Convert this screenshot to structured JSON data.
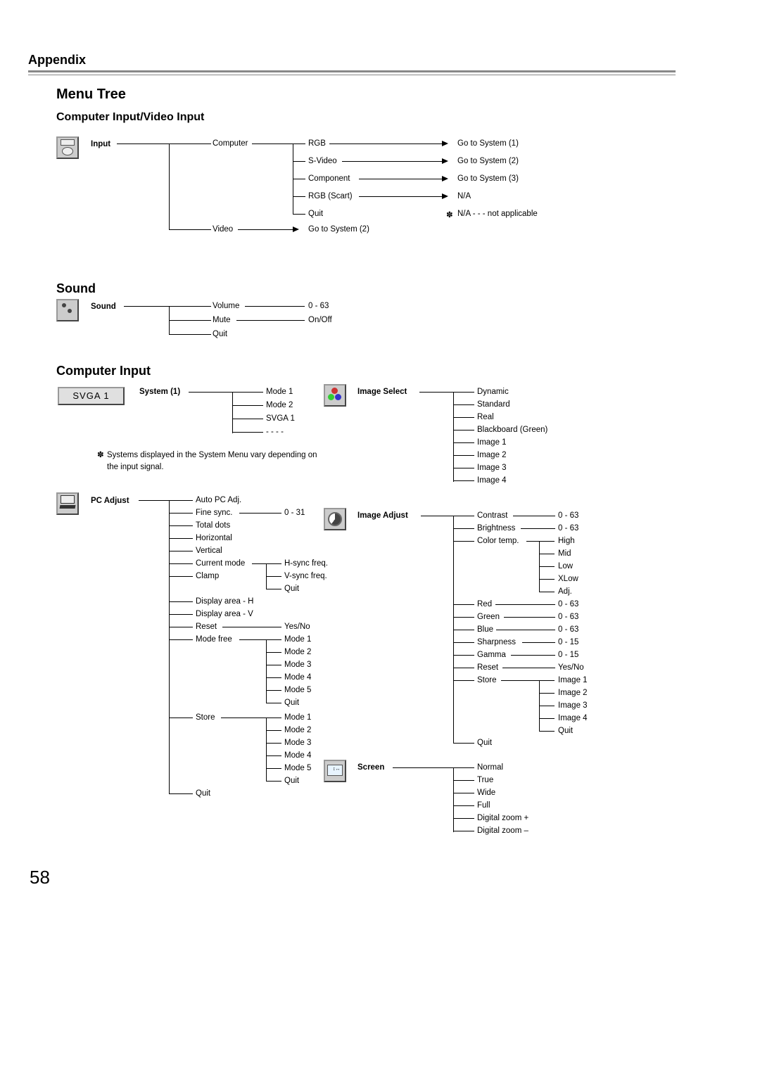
{
  "appendix": "Appendix",
  "title": "Menu Tree",
  "s1": "Computer Input/Video Input",
  "s2": "Sound",
  "s3": "Computer Input",
  "pageNum": "58",
  "input": {
    "label": "Input",
    "computer": "Computer",
    "video": "Video",
    "c_rgb": "RGB",
    "c_svideo": "S-Video",
    "c_comp": "Component",
    "c_rgbs": "RGB (Scart)",
    "c_quit": "Quit",
    "g1": "Go to System (1)",
    "g2": "Go to System (2)",
    "g3": "Go to System (3)",
    "na": "N/A",
    "note": "N/A - - - not applicable",
    "videoGoto": "Go to System (2)"
  },
  "sound": {
    "label": "Sound",
    "vol": "Volume",
    "volR": "0 - 63",
    "mute": "Mute",
    "muteR": "On/Off",
    "quit": "Quit"
  },
  "system": {
    "label": "System (1)",
    "svga": "SVGA 1",
    "m1": "Mode 1",
    "m2": "Mode 2",
    "sv": "SVGA 1",
    "dots": "- - - -",
    "note": "Systems displayed in the System Menu vary depending on the input signal."
  },
  "imgsel": {
    "label": "Image Select",
    "i": [
      "Dynamic",
      "Standard",
      "Real",
      "Blackboard (Green)",
      "Image 1",
      "Image 2",
      "Image 3",
      "Image 4"
    ]
  },
  "pcadj": {
    "label": "PC Adjust",
    "i": [
      "Auto PC Adj.",
      "Fine sync.",
      "Total dots",
      "Horizontal",
      "Vertical",
      "Current mode",
      "Clamp",
      "Display area - H",
      "Display area - V",
      "Reset",
      "Mode free",
      "Store",
      "Quit"
    ],
    "fineR": "0 - 31",
    "cm": [
      "H-sync freq.",
      "V-sync freq.",
      "Quit"
    ],
    "reset": "Yes/No",
    "modes": [
      "Mode 1",
      "Mode 2",
      "Mode 3",
      "Mode 4",
      "Mode 5",
      "Quit"
    ]
  },
  "imgadj": {
    "label": "Image Adjust",
    "a": [
      "Contrast",
      "Brightness",
      "Color temp.",
      "Red",
      "Green",
      "Blue",
      "Sharpness",
      "Gamma",
      "Reset",
      "Store",
      "Quit"
    ],
    "ar": [
      "0 - 63",
      "0 - 63",
      "",
      "0 - 63",
      "0 - 63",
      "0 - 63",
      "0 - 15",
      "0 - 15",
      "Yes/No",
      "",
      ""
    ],
    "ct": [
      "High",
      "Mid",
      "Low",
      "XLow",
      "Adj."
    ],
    "st": [
      "Image 1",
      "Image 2",
      "Image 3",
      "Image 4",
      "Quit"
    ]
  },
  "screen": {
    "label": "Screen",
    "i": [
      "Normal",
      "True",
      "Wide",
      "Full",
      "Digital zoom +",
      "Digital zoom –"
    ]
  }
}
